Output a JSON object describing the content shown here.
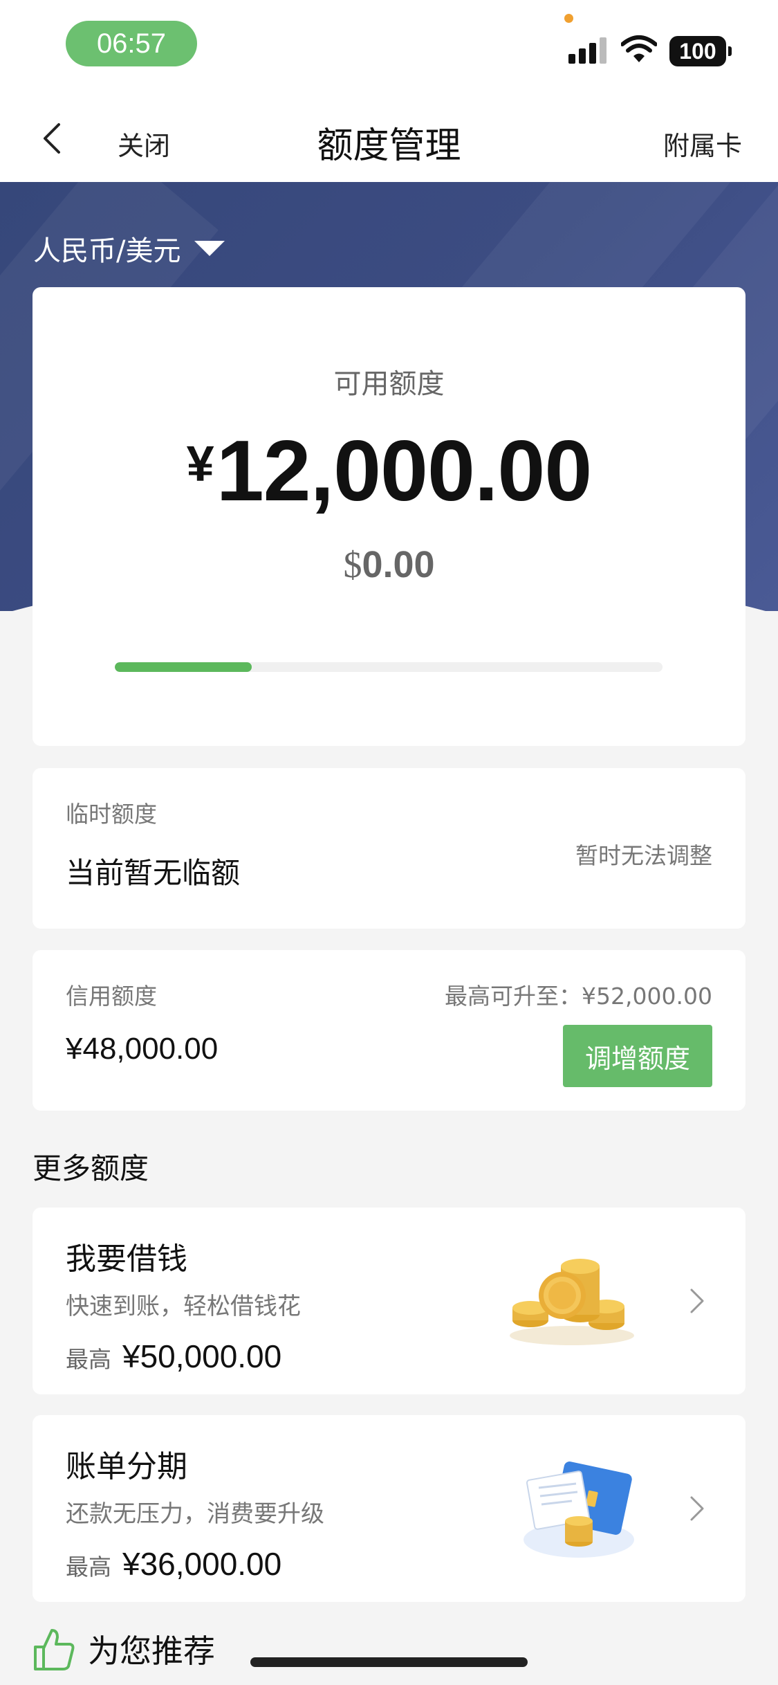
{
  "status_bar": {
    "time": "06:57",
    "battery": "100"
  },
  "nav": {
    "back_icon": "chevron-left-icon",
    "close": "关闭",
    "title": "额度管理",
    "sub_card": "附属卡"
  },
  "currency_selector": {
    "label": "人民币/美元",
    "icon": "caret-down-icon"
  },
  "available": {
    "label": "可用额度",
    "currency_symbol": "¥",
    "amount": "12,000.00",
    "usd_symbol": "$",
    "usd_amount": "0.00",
    "progress_fraction": 0.25,
    "progress_color": "#5cb85c"
  },
  "temp_limit": {
    "label": "临时额度",
    "value": "当前暂无临额",
    "note": "暂时无法调整"
  },
  "credit_limit": {
    "label": "信用额度",
    "value": "¥48,000.00",
    "max_note": "最高可升至：¥52,000.00",
    "button": "调增额度",
    "button_color": "#66bb6a"
  },
  "more_title": "更多额度",
  "offers": [
    {
      "title": "我要借钱",
      "subtitle": "快速到账，轻松借钱花",
      "max_label": "最高",
      "max_value": "¥50,000.00",
      "icon": "gold-coins-icon"
    },
    {
      "title": "账单分期",
      "subtitle": "还款无压力，消费要升级",
      "max_label": "最高",
      "max_value": "¥36,000.00",
      "icon": "card-bill-coins-icon"
    }
  ],
  "recommend": {
    "icon": "thumbs-up-icon",
    "label": "为您推荐"
  },
  "colors": {
    "banner": "#3c4c82",
    "accent_green": "#66bb6a"
  }
}
